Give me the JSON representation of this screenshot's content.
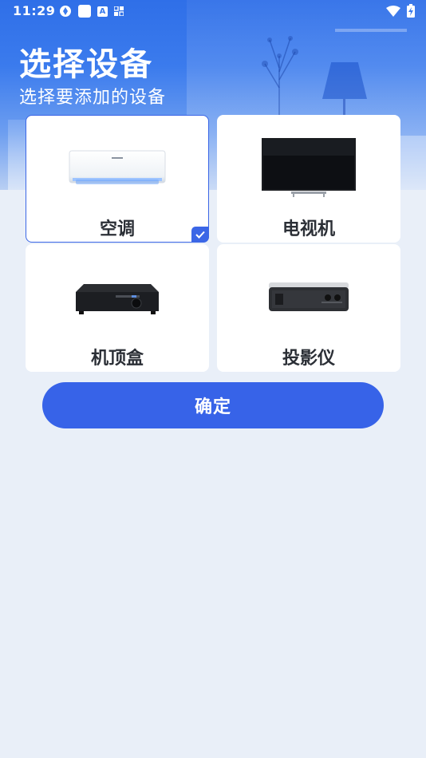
{
  "status_bar": {
    "time": "11:29",
    "left_icons": [
      "network-speed-icon",
      "white-square-icon",
      "text-a-icon",
      "grid-icon"
    ],
    "right_icons": [
      "wifi-icon",
      "battery-charging-icon"
    ]
  },
  "header": {
    "title": "选择设备",
    "subtitle": "选择要添加的设备"
  },
  "devices": [
    {
      "label": "空调",
      "selected": true,
      "icon": "air-conditioner-image"
    },
    {
      "label": "电视机",
      "selected": false,
      "icon": "television-image"
    },
    {
      "label": "机顶盒",
      "selected": false,
      "icon": "set-top-box-image"
    },
    {
      "label": "投影仪",
      "selected": false,
      "icon": "projector-image"
    }
  ],
  "confirm_label": "确定",
  "colors": {
    "accent": "#3763e8",
    "background": "#e9eff8",
    "card": "#ffffff",
    "text": "#2b2f36"
  }
}
